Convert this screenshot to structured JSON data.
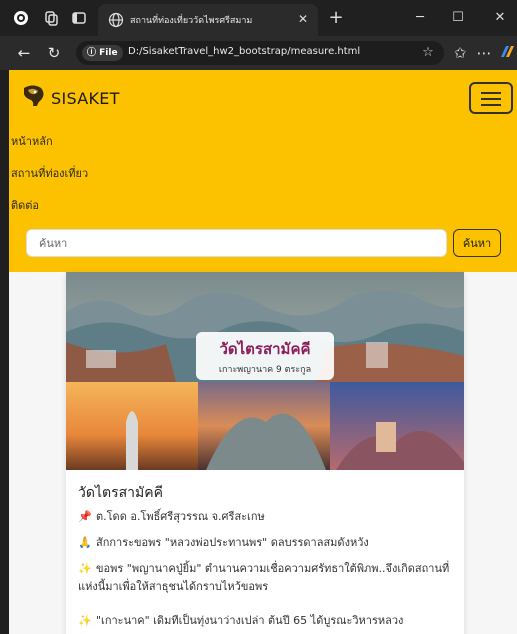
{
  "browser": {
    "tab_title": "สถานที่ท่องเที่ยววัดไพรศรีสมาม",
    "new_tab": "+",
    "file_chip": "File",
    "url": "D:/SisaketTravel_hw2_bootstrap/measure.html",
    "icons": [
      "edge-icon",
      "workspaces-icon",
      "tab-actions-icon",
      "globe-icon",
      "close-icon",
      "back-icon",
      "reload-icon",
      "info-icon",
      "star-icon",
      "favorites-icon",
      "more-icon",
      "copilot-icon"
    ]
  },
  "navbar": {
    "brand": "SISAKET",
    "links": [
      "หน้าหลัก",
      "สถานที่ท่องเที่ยว",
      "ติดต่อ"
    ],
    "search_placeholder": "ค้นหา",
    "search_button": "ค้นหา",
    "colors": {
      "navbar_bg": "#fcc200"
    }
  },
  "card": {
    "banner_title": "วัดไตรสามัคคี",
    "banner_subtitle": "เกาะพญานาค 9 ตระกูล",
    "title": "วัดไตรสามัคคี",
    "lines": [
      {
        "icon": "pin-icon",
        "glyph": "📌",
        "text": "ต.โดด อ.โพธิ์ศรีสุวรรณ จ.ศรีสะเกษ"
      },
      {
        "icon": "pray-icon",
        "glyph": "🙏",
        "text": "สักการะขอพร \"หลวงพ่อประทานพร\" ดลบรรดาลสมดังหวัง"
      },
      {
        "icon": "sparkle-icon",
        "glyph": "✨",
        "text": "ขอพร \"พญานาคปู่ยิ้ม\" ตำนานความเชื่อความศรัทธาใต้พิภพ..จึงเกิดสถานที่แห่งนี้มาเพื่อให้สาธุชนได้กราบไหว้ขอพร"
      },
      {
        "icon": "sparkle-icon",
        "glyph": "✨",
        "text": "\"เกาะนาค\" เดิมทีเป็นทุ่งนาว่างเปล่า ต้นปี 65 ได้บูรณะวิหารหลวง"
      }
    ]
  }
}
